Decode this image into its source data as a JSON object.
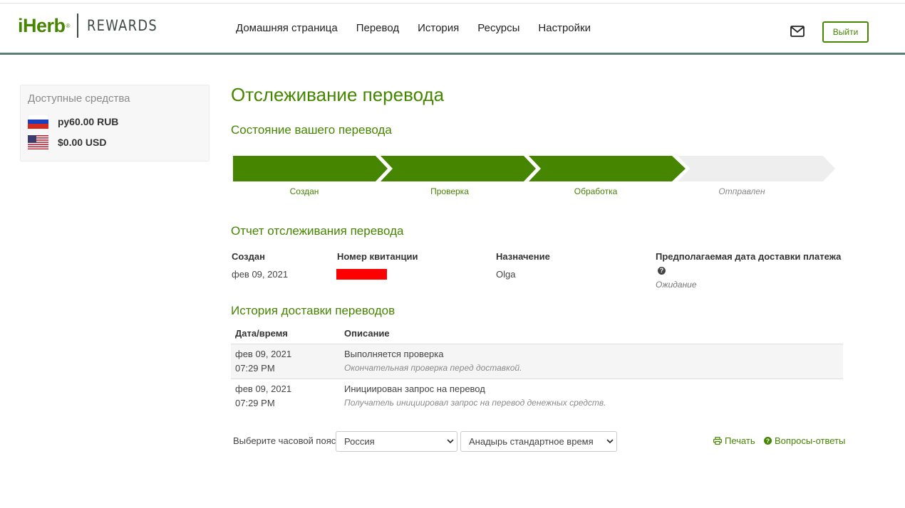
{
  "header": {
    "logo_main": "iHerb",
    "logo_reg": "®",
    "logo_sub": "REWARDS",
    "nav": [
      "Домашняя страница",
      "Перевод",
      "История",
      "Ресурсы",
      "Настройки"
    ],
    "logout_label": "Выйти"
  },
  "sidebar": {
    "title": "Доступные средства",
    "balances": [
      {
        "flag": "russia-flag-icon",
        "amount": "ру60.00 RUB"
      },
      {
        "flag": "usa-flag-icon",
        "amount": "$0.00 USD"
      }
    ]
  },
  "main": {
    "title": "Отслеживание перевода",
    "status_heading": "Состояние вашего перевода",
    "steps": [
      {
        "label": "Создан",
        "done": true
      },
      {
        "label": "Проверка",
        "done": true
      },
      {
        "label": "Обработка",
        "done": true
      },
      {
        "label": "Отправлен",
        "done": false
      }
    ],
    "report_heading": "Отчет отслеживания перевода",
    "report": {
      "created_label": "Создан",
      "created_value": "фев 09, 2021",
      "receipt_label": "Номер квитанции",
      "destination_label": "Назначение",
      "destination_value": "Olga",
      "eta_label": "Предполагаемая дата доставки платежа",
      "eta_value": "Ожидание"
    },
    "history_heading": "История доставки переводов",
    "history_columns": [
      "Дата/время",
      "Описание"
    ],
    "history_rows": [
      {
        "date": "фев 09, 2021",
        "time": "07:29 PM",
        "title": "Выполняется проверка",
        "detail": "Окончательная проверка перед доставкой."
      },
      {
        "date": "фев 09, 2021",
        "time": "07:29 PM",
        "title": "Инициирован запрос на перевод",
        "detail": "Получатель инициировал запрос на перевод денежных средств."
      }
    ],
    "timezone_label": "Выберите часовой пояс",
    "timezone_country": "Россия",
    "timezone_zone": "Анадырь стандартное время",
    "print_label": "Печать",
    "faq_label": "Вопросы-ответы"
  },
  "colors": {
    "brand_green": "#458500",
    "header_border": "#5d7d72",
    "redaction": "#ff0000",
    "pending_step": "#eeeeee"
  }
}
